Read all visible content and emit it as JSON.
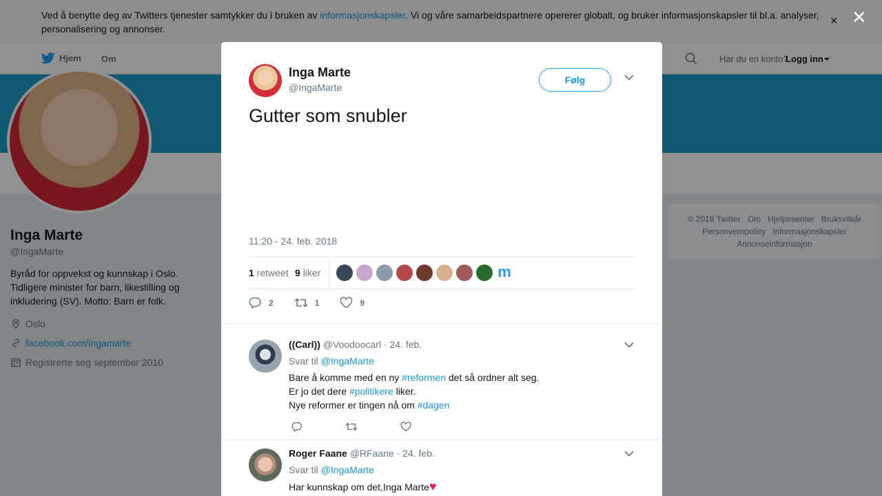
{
  "cookie": {
    "text_before": "Ved å benytte deg av Twitters tjenester samtykker du i bruken av ",
    "link": "informasjonskapsler",
    "text_after": ". Vi og våre samarbeidspartnere opererer globalt, og bruker informasjonskapsler til bl.a. analyser, personalisering og annonser.",
    "close": "×"
  },
  "nav": {
    "home": "Hjem",
    "about": "Om",
    "login_question": "Har du en konto?",
    "login": "Logg inn"
  },
  "profile": {
    "name": "Inga Marte",
    "handle": "@IngaMarte",
    "bio": "Byråd for oppvekst og kunnskap i Oslo. Tidligere minister for barn, likestilling og inkludering (SV). Motto: Barn er folk.",
    "location": "Oslo",
    "website": "facebook.com/ingamarte",
    "joined": "Registrerte seg september 2010"
  },
  "footer": {
    "links": [
      "© 2018 Twitter",
      "Om",
      "Hjelpesenter",
      "Bruksvilkår",
      "Personvernpolicy",
      "Informasjonskapsler",
      "Annonseinformasjon"
    ]
  },
  "overlay": {
    "close": "✕"
  },
  "tweet": {
    "name": "Inga Marte",
    "handle": "@IngaMarte",
    "follow": "Følg",
    "text": "Gutter som snubler",
    "time": "11:20 - 24. feb. 2018",
    "retweets": "1",
    "retweets_label": "retweet",
    "likes": "9",
    "likes_label": "liker",
    "reply_count": "2",
    "retweet_count": "1",
    "like_count": "9",
    "liker_colors": [
      "#3a4a5a",
      "#c9a7c9",
      "#8a9aa8",
      "#b34a4a",
      "#6b3a2a",
      "#d8b090",
      "#a05a5a",
      "#2a6a2a"
    ],
    "liker_m": "m"
  },
  "replies": [
    {
      "name": "((Carl))",
      "handle": "@Voodoocarl",
      "date": "· 24. feb.",
      "reply_to_label": "Svar til",
      "reply_to": "@IngaMarte",
      "line1_a": "Bare å komme med en ny ",
      "line1_tag": "#reformen",
      "line1_b": " det så ordner alt seg.",
      "line2_a": "Er jo det dere ",
      "line2_tag": "#politikere",
      "line2_b": " liker.",
      "line3_a": "Nye reformer er tingen nå om ",
      "line3_tag": "#dagen"
    },
    {
      "name": "Roger Faane",
      "handle": "@RFaane",
      "date": "· 24. feb.",
      "reply_to_label": "Svar til",
      "reply_to": "@IngaMarte",
      "text": "Har kunnskap om det,Inga Marte",
      "emoji": "♥"
    }
  ]
}
